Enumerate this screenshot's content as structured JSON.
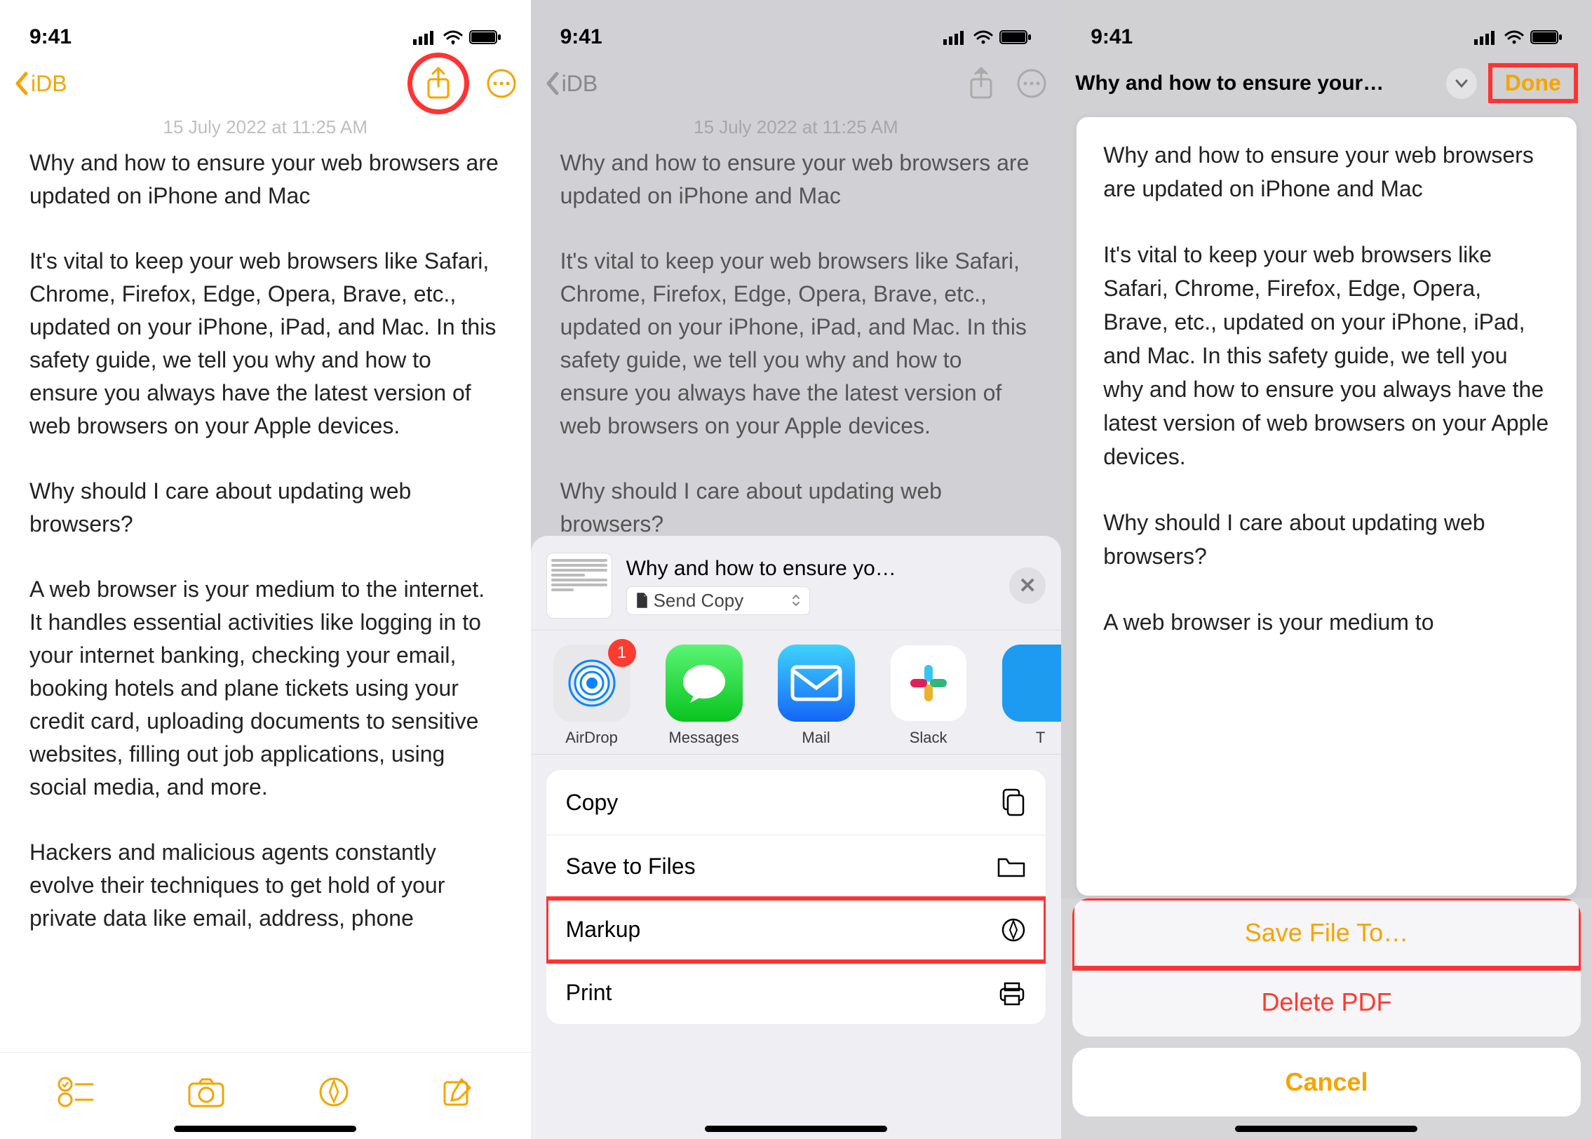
{
  "status": {
    "time": "9:41"
  },
  "nav": {
    "back_label": "iDB"
  },
  "note": {
    "date": "15 July 2022 at 11:25 AM",
    "title": "Why and how to ensure your web browsers are updated on iPhone and Mac",
    "p1": "It's vital to keep your web browsers like Safari, Chrome, Firefox, Edge, Opera, Brave, etc., updated on your iPhone, iPad, and Mac. In this safety guide, we tell you why and how to ensure you always have the latest version of web browsers on your Apple devices.",
    "p2": "Why should I care about updating web browsers?",
    "p3": "A web browser is your medium to the internet. It handles essential activities like logging in to your internet banking, checking your email, booking hotels and plane tickets using your credit card, uploading documents to sensitive websites, filling out job applications, using social media, and more.",
    "p4": "Hackers and malicious agents constantly evolve their techniques to get hold of your private data like email, address, phone"
  },
  "share": {
    "title": "Why and how to ensure yo…",
    "send_copy": "Send Copy",
    "apps": [
      {
        "name": "AirDrop",
        "badge": "1"
      },
      {
        "name": "Messages"
      },
      {
        "name": "Mail"
      },
      {
        "name": "Slack"
      },
      {
        "name": "T"
      }
    ],
    "actions": {
      "copy": "Copy",
      "save_files": "Save to Files",
      "markup": "Markup",
      "print": "Print"
    }
  },
  "markup": {
    "title": "Why and how to ensure your…",
    "done": "Done",
    "preview_p3_truncated": "A web browser is your medium to",
    "save": "Save File To…",
    "delete": "Delete PDF",
    "cancel": "Cancel"
  }
}
